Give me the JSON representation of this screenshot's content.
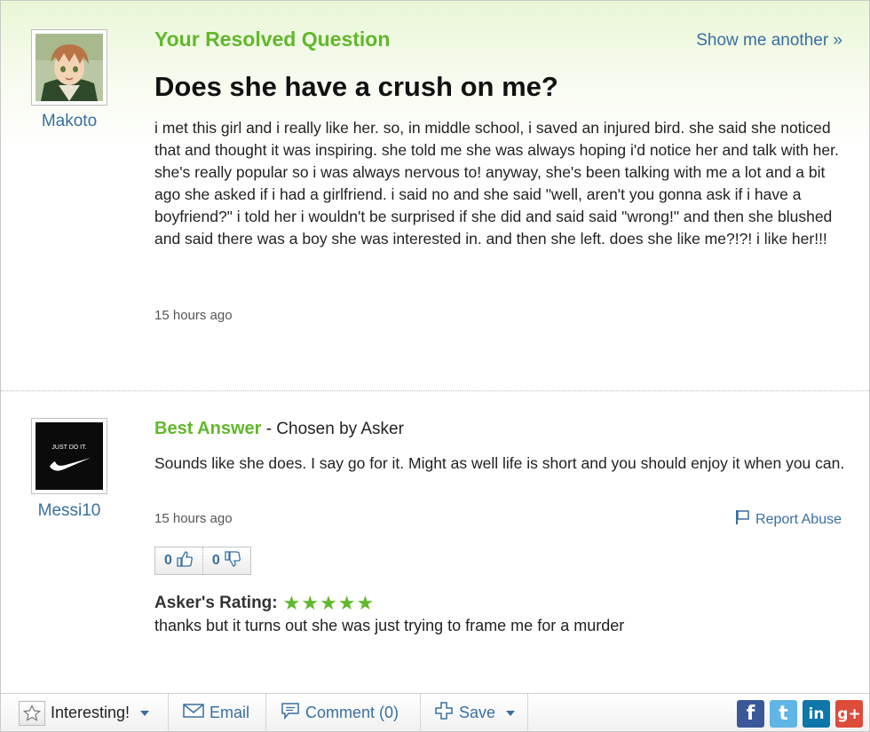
{
  "question": {
    "section_title": "Your Resolved Question",
    "show_another": "Show me another »",
    "title": "Does she have a crush on me?",
    "body": "i met this girl and i really like her. so, in middle school, i saved an injured bird. she said she noticed that and thought it was inspiring. she told me she was always hoping i'd notice her and talk with her. she's really popular so i was always nervous to! anyway, she's been talking with me a lot and a bit ago she asked if i had a girlfriend. i said no and she said \"well, aren't you gonna ask if i have a boyfriend?\" i told her i wouldn't be surprised if she did and said said \"wrong!\" and then she blushed and said there was a boy she was interested in. and then she left. does she like me?!?! i like her!!!",
    "asker": "Makoto",
    "timestamp": "15 hours ago"
  },
  "answer": {
    "best_label": "Best Answer",
    "chosen_by": " - Chosen by Asker",
    "body": "Sounds like she does. I say go for it. Might as well life is short and you should enjoy it when you can.",
    "answerer": "Messi10",
    "avatar_text": "JUST DO IT.",
    "timestamp": "15 hours ago",
    "report_abuse": "Report Abuse",
    "thumbs_up": "0",
    "thumbs_down": "0",
    "rating_label": "Asker's Rating:",
    "rating_stars": "★★★★★",
    "rating_value": 5,
    "rating_comment": "thanks but it turns out she was just trying to frame me for a murder"
  },
  "toolbar": {
    "interesting": "Interesting!",
    "email": "Email",
    "comment": "Comment (0)",
    "save": "Save",
    "social": [
      "f",
      "t",
      "in",
      "g+"
    ]
  },
  "colors": {
    "accent_green": "#61b82b",
    "link_blue": "#386fa0",
    "facebook": "#3b5998",
    "twitter": "#5eb5e6",
    "linkedin": "#0e76a8",
    "googleplus": "#dd4b39"
  }
}
